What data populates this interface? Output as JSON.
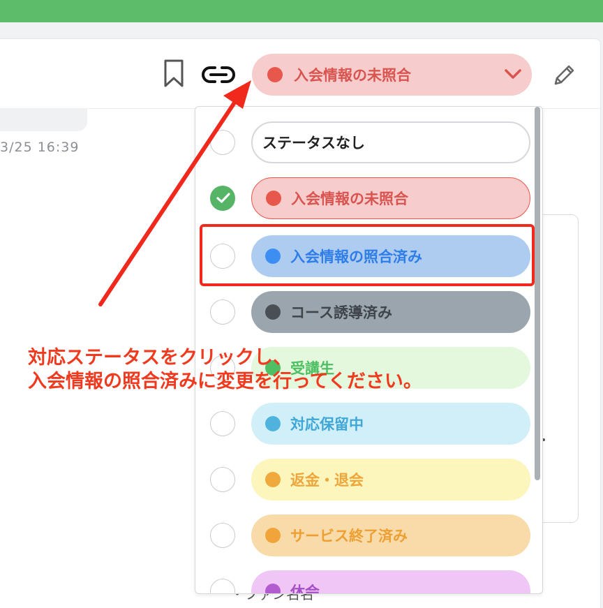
{
  "header": {
    "status_button": {
      "label": "入会情報の未照合",
      "dot_color": "#e8574c",
      "bg_color": "#f7cccc"
    },
    "icons": [
      "bookmark-icon",
      "link-icon",
      "edit-icon",
      "chevron-down-icon"
    ]
  },
  "background": {
    "timestamp": "3/25 16:39",
    "bottom_text": "・ファン名名"
  },
  "status_options": [
    {
      "label": "ステータスなし",
      "selected": false,
      "dot_color": "",
      "bg": "#ffffff",
      "text_color": "#222222"
    },
    {
      "label": "入会情報の未照合",
      "selected": true,
      "dot_color": "#e8574c",
      "bg": "#f7cccc",
      "text_color": "#d9534f"
    },
    {
      "label": "入会情報の照合済み",
      "selected": false,
      "dot_color": "#3d8ef2",
      "bg": "#aecbf0",
      "text_color": "#2f7de8"
    },
    {
      "label": "コース誘導済み",
      "selected": false,
      "dot_color": "#4a4f55",
      "bg": "#9aa5ad",
      "text_color": "#3f454b"
    },
    {
      "label": "受講生",
      "selected": false,
      "dot_color": "#4fbf63",
      "bg": "#e3f8dd",
      "text_color": "#4fbf63"
    },
    {
      "label": "対応保留中",
      "selected": false,
      "dot_color": "#4fb3de",
      "bg": "#d1eff9",
      "text_color": "#3fa6d6"
    },
    {
      "label": "返金・退会",
      "selected": false,
      "dot_color": "#f0a93c",
      "bg": "#fcf6bd",
      "text_color": "#eea53b"
    },
    {
      "label": "サービス終了済み",
      "selected": false,
      "dot_color": "#f0a43a",
      "bg": "#f8dba8",
      "text_color": "#ee9f34"
    },
    {
      "label": "休会",
      "selected": false,
      "dot_color": "#b25cd0",
      "bg": "#efc6f6",
      "text_color": "#a64fc6"
    }
  ],
  "annotation": {
    "line1": "対応ステータスをクリックし、",
    "line2": "入会情報の照合済みに変更を行ってください。",
    "color": "#f03a1f"
  }
}
